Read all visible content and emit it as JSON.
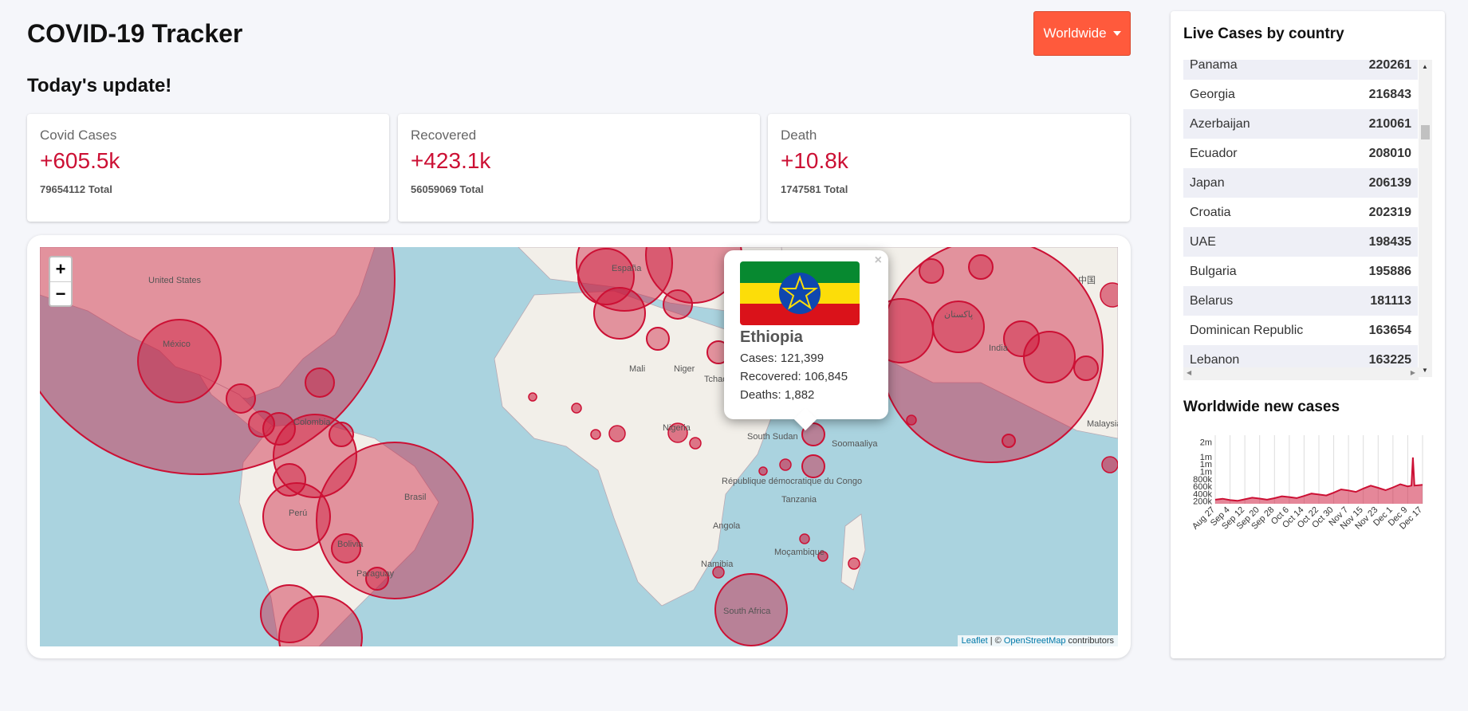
{
  "header": {
    "title": "COVID-19 Tracker",
    "subtitle": "Today's update!"
  },
  "dropdown": {
    "selected": "Worldwide"
  },
  "cards": [
    {
      "title": "Covid Cases",
      "value": "+605.5k",
      "total": "79654112 Total"
    },
    {
      "title": "Recovered",
      "value": "+423.1k",
      "total": "56059069 Total"
    },
    {
      "title": "Death",
      "value": "+10.8k",
      "total": "1747581 Total"
    }
  ],
  "map": {
    "zoom_in": "+",
    "zoom_out": "−",
    "attribution": {
      "leaflet": "Leaflet",
      "sep": " | © ",
      "osm": "OpenStreetMap",
      "suffix": " contributors"
    },
    "labels": [
      "United States",
      "México",
      "Colombia",
      "Perú",
      "Brasil",
      "Bolivia",
      "Paraguay",
      "Mali",
      "Niger",
      "Tchad",
      "Nigeria",
      "South Sudan",
      "Soomaaliya",
      "République démocratique du Congo",
      "Tanzania",
      "Angola",
      "Namibia",
      "Moçambique",
      "South Africa",
      "India",
      "Malaysia",
      "España",
      "中国",
      "پاکستان"
    ],
    "popup": {
      "close": "×",
      "country": "Ethiopia",
      "cases": "Cases: 121,399",
      "recovered": "Recovered: 106,845",
      "deaths": "Deaths: 1,882",
      "flag_colors": [
        "#078930",
        "#fcdd09",
        "#da121a",
        "#0f47af"
      ]
    }
  },
  "sidebar": {
    "live_title": "Live Cases by country",
    "countries": [
      {
        "name": "Panama",
        "cases": "220261"
      },
      {
        "name": "Georgia",
        "cases": "216843"
      },
      {
        "name": "Azerbaijan",
        "cases": "210061"
      },
      {
        "name": "Ecuador",
        "cases": "208010"
      },
      {
        "name": "Japan",
        "cases": "206139"
      },
      {
        "name": "Croatia",
        "cases": "202319"
      },
      {
        "name": "UAE",
        "cases": "198435"
      },
      {
        "name": "Bulgaria",
        "cases": "195886"
      },
      {
        "name": "Belarus",
        "cases": "181113"
      },
      {
        "name": "Dominican Republic",
        "cases": "163654"
      },
      {
        "name": "Lebanon",
        "cases": "163225"
      }
    ],
    "chart_title": "Worldwide new cases"
  },
  "chart_data": {
    "type": "area",
    "title": "Worldwide new cases",
    "x": [
      "Aug 27",
      "Sep 4",
      "Sep 12",
      "Sep 20",
      "Sep 28",
      "Oct 6",
      "Oct 14",
      "Oct 22",
      "Oct 30",
      "Nov 7",
      "Nov 15",
      "Nov 23",
      "Dec 1",
      "Dec 9",
      "Dec 17"
    ],
    "y_ticks": [
      "200k",
      "400k",
      "600k",
      "800k",
      "1m",
      "1m",
      "1m",
      "2m"
    ],
    "values": [
      260000,
      250000,
      270000,
      290000,
      300000,
      330000,
      360000,
      400000,
      450000,
      510000,
      560000,
      580000,
      590000,
      620000,
      660000
    ],
    "peak": {
      "x": "Dec 11",
      "value": 1400000
    },
    "ylim": [
      150000,
      2000000
    ],
    "color": "#cc1034"
  },
  "colors": {
    "accent": "#cc1034",
    "dropdown": "#ff5a3c",
    "ocean": "#aad3df",
    "land": "#f2efe9"
  }
}
